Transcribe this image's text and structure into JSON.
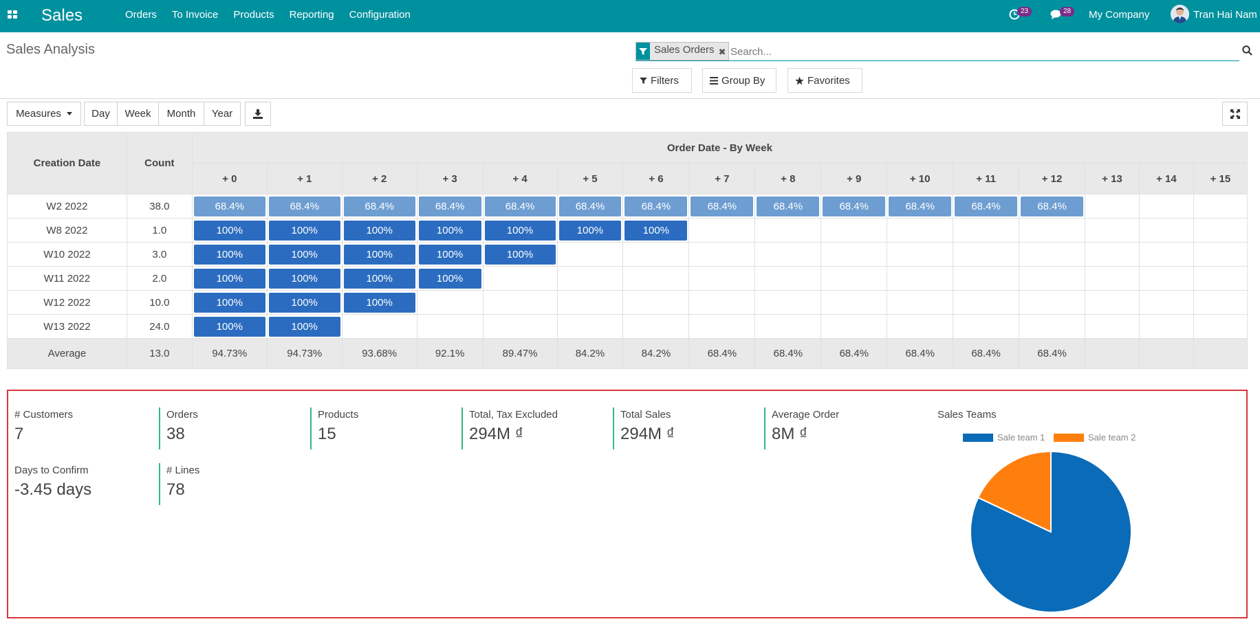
{
  "navbar": {
    "app_name": "Sales",
    "menu": [
      "Orders",
      "To Invoice",
      "Products",
      "Reporting",
      "Configuration"
    ],
    "activity_count": "23",
    "message_count": "28",
    "company": "My Company",
    "user": "Tran Hai Nam"
  },
  "control_panel": {
    "title": "Sales Analysis",
    "facet": "Sales Orders",
    "facet_remove": "✖",
    "search_placeholder": "Search...",
    "filters_label": "Filters",
    "groupby_label": "Group By",
    "favorites_label": "Favorites",
    "measures_label": "Measures",
    "intervals": [
      "Day",
      "Week",
      "Month",
      "Year"
    ]
  },
  "cohort": {
    "col_creation_date": "Creation Date",
    "col_count": "Count",
    "group_header": "Order Date - By Week",
    "periods": [
      "+ 0",
      "+ 1",
      "+ 2",
      "+ 3",
      "+ 4",
      "+ 5",
      "+ 6",
      "+ 7",
      "+ 8",
      "+ 9",
      "+ 10",
      "+ 11",
      "+ 12",
      "+ 13",
      "+ 14",
      "+ 15"
    ],
    "rows": [
      {
        "label": "W2 2022",
        "count": "38.0",
        "values": [
          "68.4%",
          "68.4%",
          "68.4%",
          "68.4%",
          "68.4%",
          "68.4%",
          "68.4%",
          "68.4%",
          "68.4%",
          "68.4%",
          "68.4%",
          "68.4%",
          "68.4%"
        ]
      },
      {
        "label": "W8 2022",
        "count": "1.0",
        "values": [
          "100%",
          "100%",
          "100%",
          "100%",
          "100%",
          "100%",
          "100%"
        ]
      },
      {
        "label": "W10 2022",
        "count": "3.0",
        "values": [
          "100%",
          "100%",
          "100%",
          "100%",
          "100%"
        ]
      },
      {
        "label": "W11 2022",
        "count": "2.0",
        "values": [
          "100%",
          "100%",
          "100%",
          "100%"
        ]
      },
      {
        "label": "W12 2022",
        "count": "10.0",
        "values": [
          "100%",
          "100%",
          "100%"
        ]
      },
      {
        "label": "W13 2022",
        "count": "24.0",
        "values": [
          "100%",
          "100%"
        ]
      }
    ],
    "average": {
      "label": "Average",
      "count": "13.0",
      "values": [
        "94.73%",
        "94.73%",
        "93.68%",
        "92.1%",
        "89.47%",
        "84.2%",
        "84.2%",
        "68.4%",
        "68.4%",
        "68.4%",
        "68.4%",
        "68.4%",
        "68.4%",
        "",
        "",
        ""
      ]
    }
  },
  "dashboard": {
    "kpis": [
      {
        "label": "# Customers",
        "value": "7"
      },
      {
        "label": "Orders",
        "value": "38"
      },
      {
        "label": "Products",
        "value": "15"
      },
      {
        "label": "Total, Tax Excluded",
        "value": "294M ₫"
      },
      {
        "label": "Total Sales",
        "value": "294M ₫"
      },
      {
        "label": "Average Order",
        "value": "8M ₫"
      },
      {
        "label": "Days to Confirm",
        "value": "-3.45 days"
      },
      {
        "label": "# Lines",
        "value": "78"
      }
    ],
    "sales_teams": {
      "title": "Sales Teams",
      "colors": {
        "team1": "#0a6bb8",
        "team2": "#ff7f0e"
      }
    }
  },
  "chart_data": {
    "type": "pie",
    "title": "Sales Teams",
    "categories": [
      "Sale team 1",
      "Sale team 2"
    ],
    "values": [
      82,
      18
    ],
    "legend": "top"
  }
}
